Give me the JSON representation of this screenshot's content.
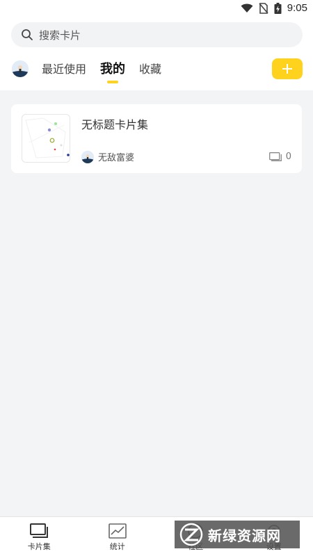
{
  "status_bar": {
    "time": "9:05",
    "icons": [
      "wifi-icon",
      "no-sim-icon",
      "battery-icon"
    ]
  },
  "search": {
    "placeholder": "搜索卡片"
  },
  "tabs": [
    {
      "label": "最近使用",
      "active": false
    },
    {
      "label": "我的",
      "active": true
    },
    {
      "label": "收藏",
      "active": false
    }
  ],
  "add_button": {
    "icon": "plus-icon"
  },
  "card": {
    "title": "无标题卡片集",
    "author": "无敌富婆",
    "count": "0"
  },
  "bottom_nav": [
    {
      "label": "卡片集",
      "icon": "cards-icon"
    },
    {
      "label": "统计",
      "icon": "chart-icon"
    },
    {
      "label": "社区",
      "icon": "community-icon"
    },
    {
      "label": "设置",
      "icon": "settings-icon"
    }
  ],
  "watermark": {
    "text": "新绿资源网"
  },
  "colors": {
    "accent": "#ffd21e",
    "background": "#f3f4f6"
  }
}
